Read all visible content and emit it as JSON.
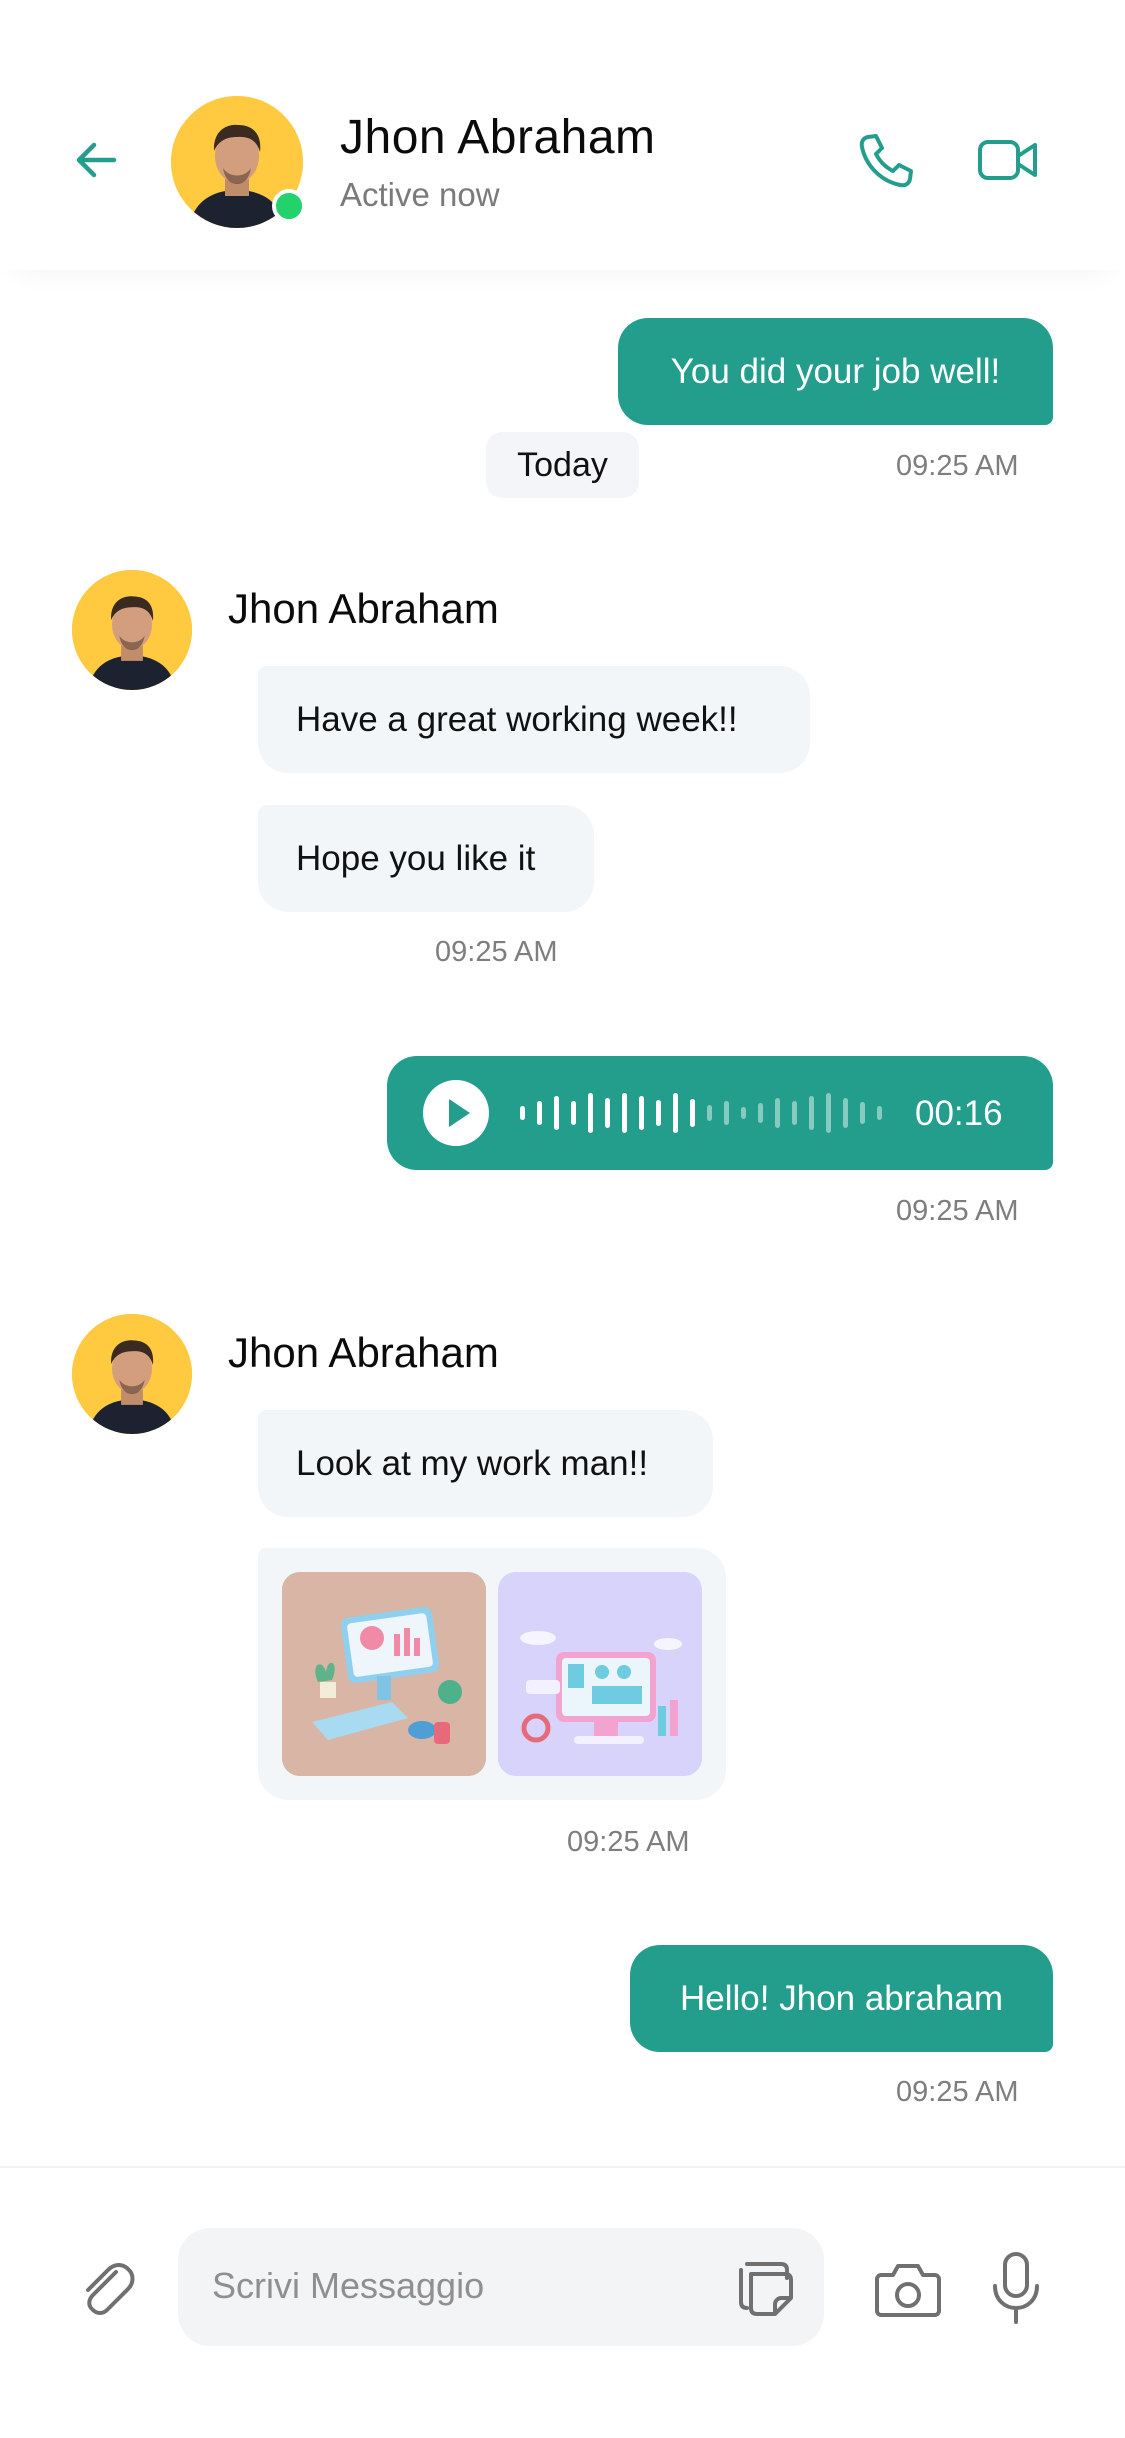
{
  "header": {
    "contact_name": "Jhon Abraham",
    "status": "Active now",
    "icons": {
      "back": "arrow-left-icon",
      "call": "phone-icon",
      "video": "video-camera-icon"
    }
  },
  "messages": {
    "m1": {
      "text": "You did your job well!",
      "time": "09:25 AM"
    },
    "day_label": "Today",
    "g1": {
      "sender": "Jhon Abraham",
      "msg1": "Have a great working week!!",
      "msg2": "Hope you like it",
      "time": "09:25 AM"
    },
    "voice": {
      "duration": "00:16",
      "time": "09:25 AM",
      "progress": 0.5
    },
    "g2": {
      "sender": "Jhon Abraham",
      "msg1": "Look at my work man!!",
      "time": "09:25 AM"
    },
    "m_last": {
      "text": "Hello! Jhon abraham",
      "time": "09:25 AM"
    }
  },
  "composer": {
    "placeholder": "Scrivi Messaggio",
    "icons": {
      "attach": "paperclip-icon",
      "sticker": "sticker-icon",
      "camera": "camera-icon",
      "mic": "microphone-icon"
    }
  },
  "colors": {
    "accent": "#239e8d",
    "bubble_in": "#f3f6f9",
    "online": "#22d36b",
    "avatar_bg": "#ffc940"
  }
}
